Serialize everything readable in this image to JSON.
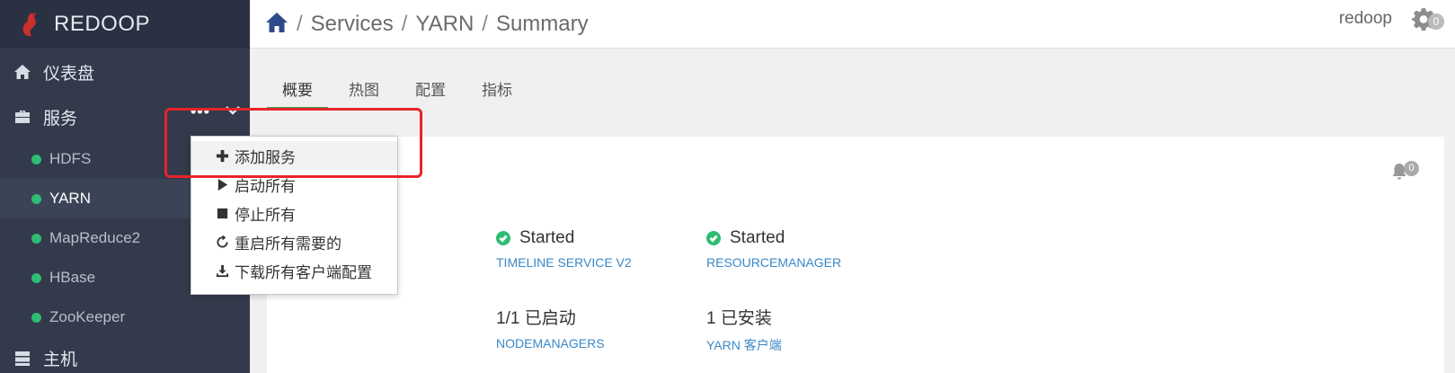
{
  "brand": {
    "name": "REDOOP",
    "logo_color": "#c9302c"
  },
  "sidebar": {
    "dashboard_label": "仪表盘",
    "services_label": "服务",
    "services_actions": "•••",
    "services": [
      {
        "label": "HDFS",
        "status": "green",
        "active": false
      },
      {
        "label": "YARN",
        "status": "green",
        "active": true
      },
      {
        "label": "MapReduce2",
        "status": "green",
        "active": false
      },
      {
        "label": "HBase",
        "status": "green",
        "active": false
      },
      {
        "label": "ZooKeeper",
        "status": "green",
        "active": false
      }
    ],
    "hosts_label": "主机"
  },
  "breadcrumb": {
    "sep": "/",
    "items": [
      "Services",
      "YARN",
      "Summary"
    ]
  },
  "user": {
    "name": "redoop",
    "settings_badge": "0"
  },
  "tabs": [
    {
      "label": "概要",
      "active": true
    },
    {
      "label": "热图",
      "active": false
    },
    {
      "label": "配置",
      "active": false
    },
    {
      "label": "指标",
      "active": false
    }
  ],
  "alerts": {
    "count": "0"
  },
  "summary": {
    "timeline": {
      "status": "Started",
      "name": "TIMELINE SERVICE V2"
    },
    "resourcemanager": {
      "status": "Started",
      "name": "RESOURCEMANAGER"
    },
    "nodemanagers": {
      "value": "1/1 已启动",
      "name": "NODEMANAGERS"
    },
    "clients": {
      "value": "1 已安装",
      "name": "YARN 客户端"
    }
  },
  "dropdown": {
    "items": [
      {
        "label": "添加服务",
        "icon": "plus-icon"
      },
      {
        "label": "启动所有",
        "icon": "play-icon"
      },
      {
        "label": "停止所有",
        "icon": "stop-icon"
      },
      {
        "label": "重启所有需要的",
        "icon": "refresh-icon"
      },
      {
        "label": "下载所有客户端配置",
        "icon": "download-icon"
      }
    ]
  },
  "colors": {
    "sidebar_bg": "#323a4b",
    "status_green": "#2fbc73",
    "link_blue": "#3a88c7",
    "tab_active": "#3aa651",
    "highlight_red": "#e8242a"
  }
}
